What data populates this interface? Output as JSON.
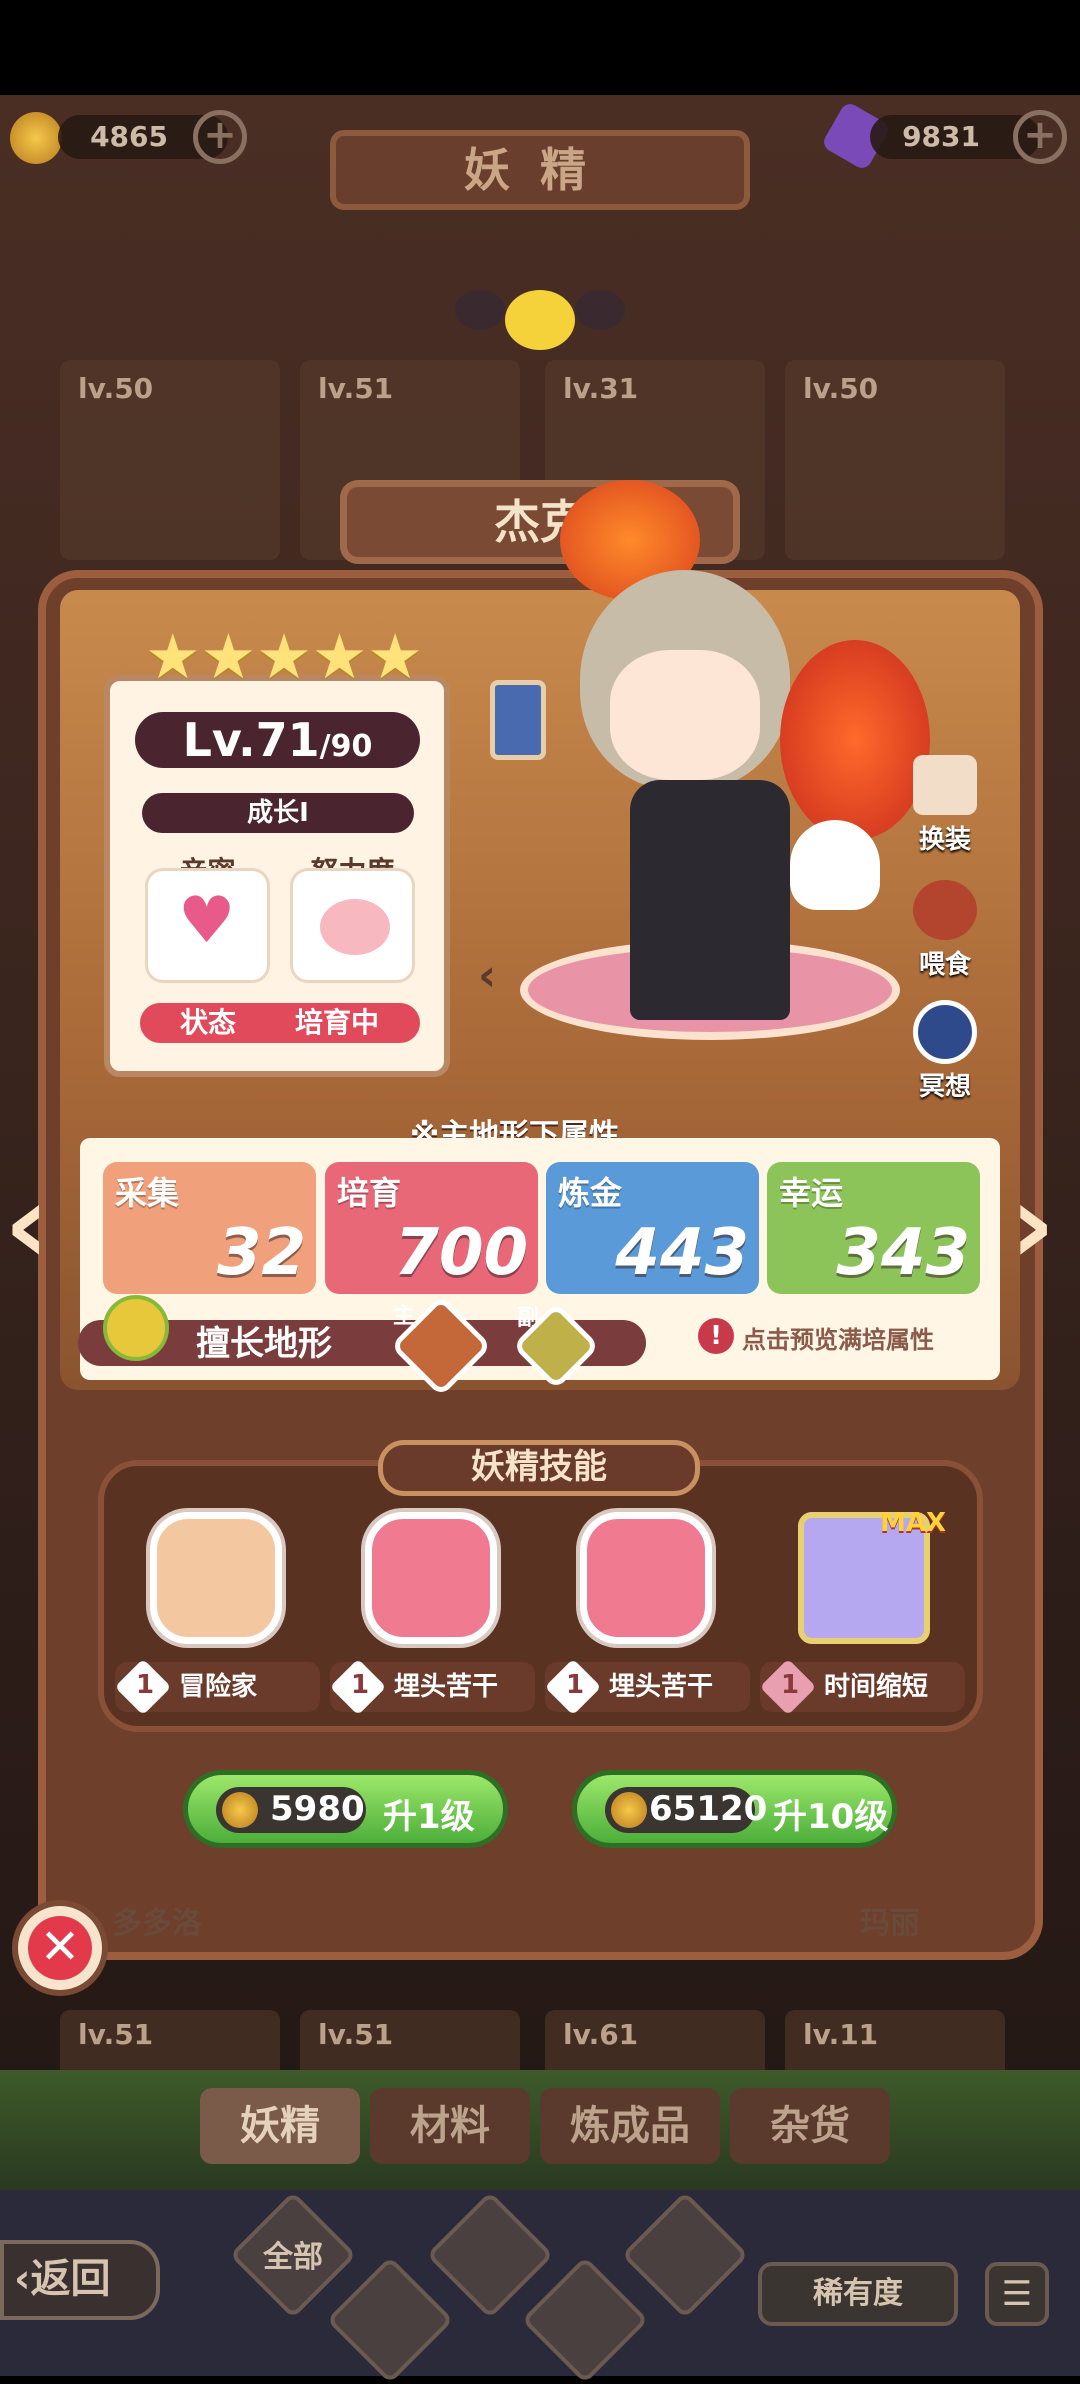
{
  "currency": {
    "coins": "4865",
    "gems": "9831"
  },
  "header_title": "妖精",
  "background_cards": [
    {
      "level": "lv.50"
    },
    {
      "level": "lv.51"
    },
    {
      "level": "lv.31"
    },
    {
      "level": "lv.50"
    }
  ],
  "bottom_cards": [
    {
      "level": "lv.51"
    },
    {
      "level": "lv.51"
    },
    {
      "level": "lv.61"
    },
    {
      "level": "lv.11"
    }
  ],
  "bottom_names": [
    "多多洛",
    "玛丽"
  ],
  "fairy": {
    "name": "杰克",
    "stars": 5,
    "level": "Lv.71",
    "max_level": "/90",
    "growth": "成长I",
    "intimacy_label": "亲密",
    "effort_label": "努力度",
    "status_label": "状态",
    "status_value": "培育中"
  },
  "side_actions": {
    "outfit": "换装",
    "feed": "喂食",
    "meditate": "冥想"
  },
  "attributes": {
    "header": "※主地形下属性",
    "items": [
      {
        "name": "采集",
        "value": "32",
        "color": "#f0a07a"
      },
      {
        "name": "培育",
        "value": "700",
        "color": "#e86878"
      },
      {
        "name": "炼金",
        "value": "443",
        "color": "#5a9ad8"
      },
      {
        "name": "幸运",
        "value": "343",
        "color": "#8cc45a"
      }
    ],
    "terrain_label": "擅长地形",
    "main_tag": "主",
    "sub_tag": "副",
    "preview_text": "点击预览满培属性"
  },
  "skills": {
    "title": "妖精技能",
    "items": [
      {
        "level": "1",
        "name": "冒险家",
        "color": "#f3c8a0"
      },
      {
        "level": "1",
        "name": "埋头苦干",
        "color": "#f07a90"
      },
      {
        "level": "1",
        "name": "埋头苦干",
        "color": "#f07a90"
      },
      {
        "level": "1",
        "name": "时间缩短",
        "color": "#b6a8f0",
        "max": "MAX"
      }
    ]
  },
  "upgrade": {
    "one": {
      "cost": "5980",
      "label": "升1级"
    },
    "ten": {
      "cost": "65120",
      "label": "升10级"
    }
  },
  "tabs": [
    "妖精",
    "材料",
    "炼成品",
    "杂货"
  ],
  "filters": {
    "all": "全部",
    "back": "返回",
    "rarity": "稀有度"
  }
}
